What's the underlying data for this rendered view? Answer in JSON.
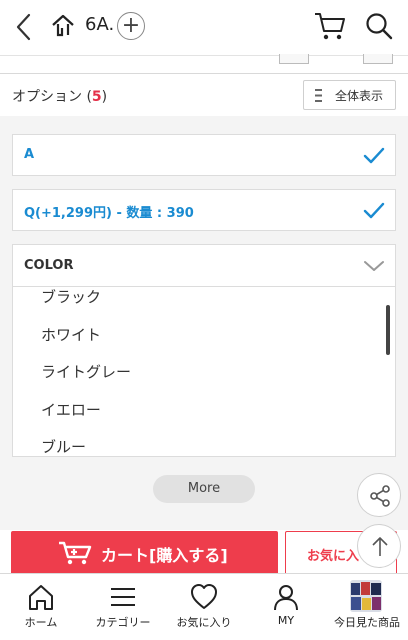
{
  "header": {
    "crumb": "6A.",
    "plus": "+"
  },
  "options": {
    "title": "オプション (",
    "count": "5",
    "close": ")",
    "view_all": "全体表示"
  },
  "selected": [
    {
      "text": "A"
    },
    {
      "text": "Q(+1,299円) - 数量 : 390"
    }
  ],
  "color": {
    "label": "COLOR",
    "items": [
      "ブラック",
      "ホワイト",
      "ライトグレー",
      "イエロー",
      "ブルー"
    ]
  },
  "more_label": "More",
  "actions": {
    "cart": "カート[購入する]",
    "favorite": "お気に入り"
  },
  "nav": [
    {
      "label": "ホーム",
      "icon": "home-icon"
    },
    {
      "label": "カテゴリー",
      "icon": "menu-icon"
    },
    {
      "label": "お気に入り",
      "icon": "heart-icon"
    },
    {
      "label": "MY",
      "icon": "person-icon"
    },
    {
      "label": "今日見た商品",
      "icon": "recent-thumb"
    }
  ],
  "colors": {
    "accent_blue": "#1a8bd1",
    "accent_red": "#ee3d4c",
    "count_red": "#e4314a"
  }
}
